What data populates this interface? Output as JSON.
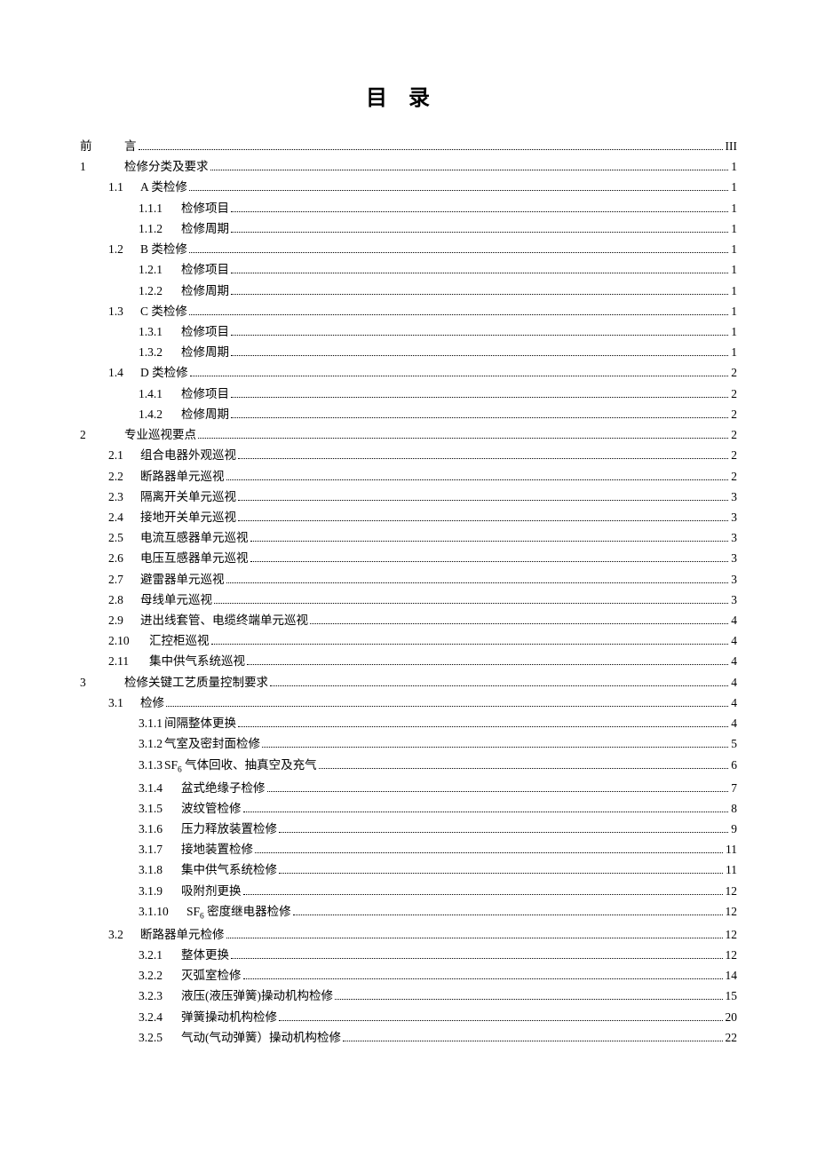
{
  "title": "目录",
  "entries": [
    {
      "level": 0,
      "numClass": "num0",
      "num": "前",
      "text": "言",
      "page": "III"
    },
    {
      "level": 0,
      "numClass": "num0b",
      "num": "1",
      "text": "检修分类及要求",
      "page": "1"
    },
    {
      "level": 1,
      "numClass": "num1",
      "num": "1.1",
      "text": "A 类检修",
      "page": "1"
    },
    {
      "level": 2,
      "numClass": "num2",
      "num": "1.1.1",
      "text": "检修项目",
      "page": "1"
    },
    {
      "level": 2,
      "numClass": "num2",
      "num": "1.1.2",
      "text": "检修周期",
      "page": "1"
    },
    {
      "level": 1,
      "numClass": "num1",
      "num": "1.2",
      "text": "B 类检修",
      "page": "1"
    },
    {
      "level": 2,
      "numClass": "num2",
      "num": "1.2.1",
      "text": "检修项目",
      "page": "1"
    },
    {
      "level": 2,
      "numClass": "num2",
      "num": "1.2.2",
      "text": "检修周期",
      "page": "1"
    },
    {
      "level": 1,
      "numClass": "num1",
      "num": "1.3",
      "text": "C 类检修",
      "page": "1"
    },
    {
      "level": 2,
      "numClass": "num2",
      "num": "1.3.1",
      "text": "检修项目",
      "page": "1"
    },
    {
      "level": 2,
      "numClass": "num2",
      "num": "1.3.2",
      "text": "检修周期",
      "page": "1"
    },
    {
      "level": 1,
      "numClass": "num1",
      "num": "1.4",
      "text": "D 类检修",
      "page": "2"
    },
    {
      "level": 2,
      "numClass": "num2",
      "num": "1.4.1",
      "text": "检修项目",
      "page": "2"
    },
    {
      "level": 2,
      "numClass": "num2",
      "num": "1.4.2",
      "text": "检修周期",
      "page": "2"
    },
    {
      "level": 0,
      "numClass": "num0b",
      "num": "2",
      "text": "专业巡视要点",
      "page": "2"
    },
    {
      "level": 1,
      "numClass": "num1",
      "num": "2.1",
      "text": "组合电器外观巡视",
      "page": "2"
    },
    {
      "level": 1,
      "numClass": "num1",
      "num": "2.2",
      "text": "断路器单元巡视",
      "page": "2"
    },
    {
      "level": 1,
      "numClass": "num1",
      "num": "2.3",
      "text": "隔离开关单元巡视",
      "page": "3"
    },
    {
      "level": 1,
      "numClass": "num1",
      "num": "2.4",
      "text": "接地开关单元巡视",
      "page": "3"
    },
    {
      "level": 1,
      "numClass": "num1",
      "num": "2.5",
      "text": "电流互感器单元巡视",
      "page": "3"
    },
    {
      "level": 1,
      "numClass": "num1",
      "num": "2.6",
      "text": "电压互感器单元巡视",
      "page": "3"
    },
    {
      "level": 1,
      "numClass": "num1",
      "num": "2.7",
      "text": "避雷器单元巡视",
      "page": "3"
    },
    {
      "level": 1,
      "numClass": "num1",
      "num": "2.8",
      "text": "母线单元巡视",
      "page": "3"
    },
    {
      "level": 1,
      "numClass": "num1",
      "num": "2.9",
      "text": "进出线套管、电缆终端单元巡视",
      "page": "4"
    },
    {
      "level": 1,
      "numClass": "num1w",
      "num": "2.10",
      "text": "汇控柜巡视",
      "page": "4"
    },
    {
      "level": 1,
      "numClass": "num1w",
      "num": "2.11",
      "text": "集中供气系统巡视",
      "page": "4"
    },
    {
      "level": 0,
      "numClass": "num0b",
      "num": "3",
      "text": "检修关键工艺质量控制要求",
      "page": "4"
    },
    {
      "level": 1,
      "numClass": "num1",
      "num": "3.1",
      "text": "检修",
      "page": "4"
    },
    {
      "level": 2,
      "numClass": "num2",
      "num": "3.1.1",
      "text": "间隔整体更换",
      "page": "4",
      "tight": true
    },
    {
      "level": 2,
      "numClass": "num2",
      "num": "3.1.2",
      "text": "气室及密封面检修",
      "page": "5",
      "tight": true
    },
    {
      "level": 2,
      "numClass": "num2",
      "num": "3.1.3",
      "text": "SF<sub>6</sub> 气体回收、抽真空及充气",
      "page": "6",
      "tight": true,
      "html": true
    },
    {
      "level": 2,
      "numClass": "num2",
      "num": "3.1.4",
      "text": "盆式绝缘子检修",
      "page": "7"
    },
    {
      "level": 2,
      "numClass": "num2",
      "num": "3.1.5",
      "text": "波纹管检修",
      "page": "8"
    },
    {
      "level": 2,
      "numClass": "num2",
      "num": "3.1.6",
      "text": "压力释放装置检修",
      "page": "9"
    },
    {
      "level": 2,
      "numClass": "num2",
      "num": "3.1.7",
      "text": "接地装置检修",
      "page": "11"
    },
    {
      "level": 2,
      "numClass": "num2",
      "num": "3.1.8",
      "text": "集中供气系统检修",
      "page": "11"
    },
    {
      "level": 2,
      "numClass": "num2",
      "num": "3.1.9",
      "text": "吸附剂更换",
      "page": "12"
    },
    {
      "level": 2,
      "numClass": "num2w",
      "num": "3.1.10",
      "text": "SF<sub>6</sub> 密度继电器检修",
      "page": "12",
      "html": true
    },
    {
      "level": 1,
      "numClass": "num1",
      "num": "3.2",
      "text": "断路器单元检修",
      "page": "12"
    },
    {
      "level": 2,
      "numClass": "num2",
      "num": "3.2.1",
      "text": "整体更换",
      "page": "12"
    },
    {
      "level": 2,
      "numClass": "num2",
      "num": "3.2.2",
      "text": "灭弧室检修",
      "page": "14"
    },
    {
      "level": 2,
      "numClass": "num2",
      "num": "3.2.3",
      "text": "液压(液压弹簧)操动机构检修",
      "page": "15"
    },
    {
      "level": 2,
      "numClass": "num2",
      "num": "3.2.4",
      "text": "弹簧操动机构检修",
      "page": "20"
    },
    {
      "level": 2,
      "numClass": "num2",
      "num": "3.2.5",
      "text": "气动(气动弹簧）操动机构检修",
      "page": "22"
    }
  ]
}
